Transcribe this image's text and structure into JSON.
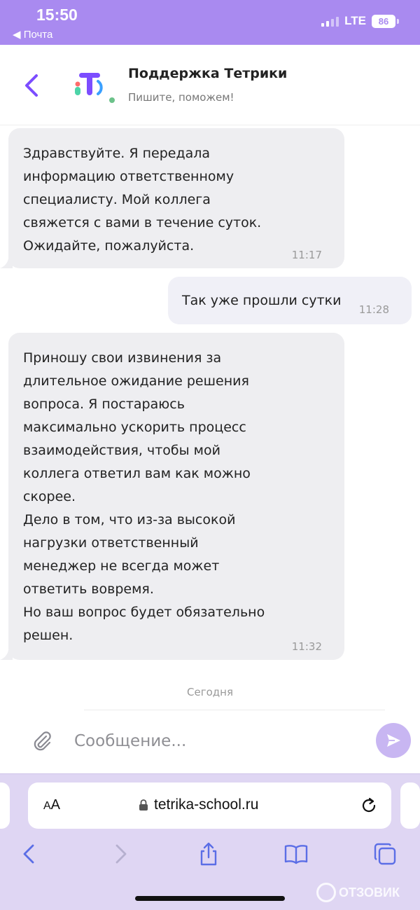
{
  "status_bar": {
    "time": "15:50",
    "back_app": "◀ Почта",
    "network": "LTE",
    "battery": "86"
  },
  "chat_header": {
    "title": "Поддержка Тетрики",
    "subtitle": "Пишите, поможем!"
  },
  "messages": [
    {
      "direction": "incoming",
      "lines": [
        "Здравствуйте. Я передала",
        "информацию ответственному",
        "специалисту. Мой коллега",
        "свяжется с вами в течение суток.",
        "Ожидайте, пожалуйста."
      ],
      "time": "11:17"
    },
    {
      "direction": "outgoing",
      "lines": [
        "Так уже прошли сутки"
      ],
      "time": "11:28"
    },
    {
      "direction": "incoming",
      "lines": [
        "Приношу свои извинения за",
        "длительное ожидание решения",
        "вопроса. Я постараюсь",
        "максимально ускорить процесс",
        "взаимодействия, чтобы мой",
        "коллега ответил вам как можно",
        "скорее.",
        "Дело в том, что из-за высокой",
        "нагрузки ответственный",
        "менеджер не всегда может",
        "ответить вовремя.",
        "Но ваш вопрос будет обязательно",
        "решен."
      ],
      "time": "11:32"
    }
  ],
  "day_separator": "Сегодня",
  "composer": {
    "placeholder": "Сообщение..."
  },
  "browser": {
    "aa_label_small": "A",
    "aa_label_large": "A",
    "url": "tetrika-school.ru"
  },
  "watermark": "ОТЗОВИК",
  "colors": {
    "accent": "#7c4dff",
    "status_bar": "#a98af0",
    "incoming_bubble": "#eeeef1",
    "outgoing_bubble": "#f0f0f7",
    "online": "#6cc28a",
    "send_button": "#c8b6f2"
  },
  "icons": [
    "back-arrow-icon",
    "tetrika-logo-icon",
    "paperclip-icon",
    "send-icon",
    "lock-icon",
    "reload-icon",
    "safari-back-icon",
    "safari-forward-icon",
    "share-icon",
    "bookmarks-icon",
    "tabs-icon"
  ]
}
